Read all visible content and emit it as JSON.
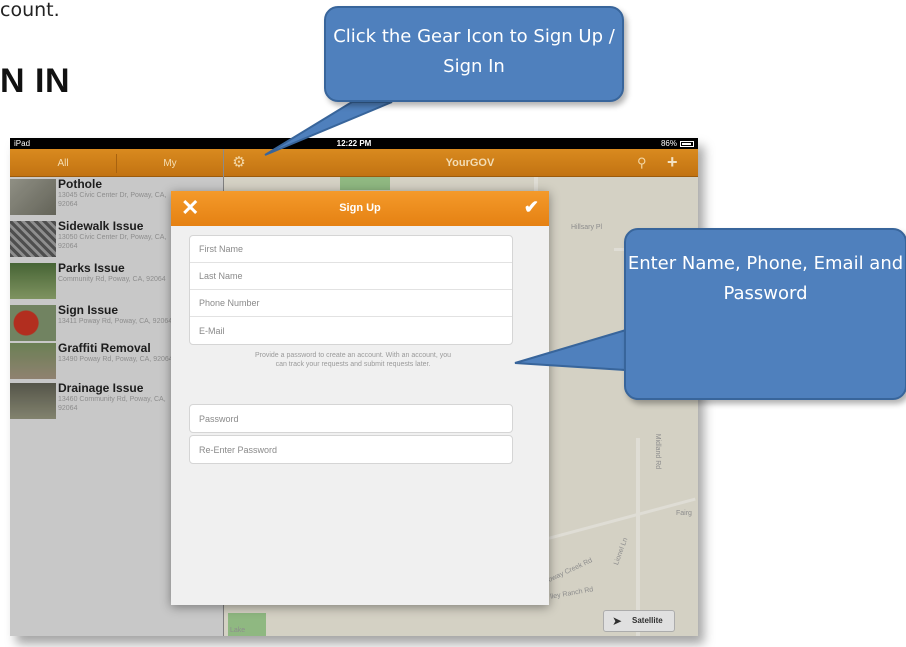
{
  "document": {
    "intro_text_fragment": "count.",
    "heading_fragment": "N IN"
  },
  "status_bar": {
    "device": "iPad",
    "time": "12:22 PM",
    "battery": "86%"
  },
  "nav": {
    "segment_all": "All",
    "segment_my": "My",
    "title": "YourGOV"
  },
  "sidebar": {
    "items": [
      {
        "title": "Pothole",
        "address": "13045 Civic Center Dr, Poway, CA, 92064"
      },
      {
        "title": "Sidewalk Issue",
        "address": "13050 Civic Center Dr, Poway, CA, 92064"
      },
      {
        "title": "Parks Issue",
        "address": "Community Rd, Poway, CA, 92064"
      },
      {
        "title": "Sign Issue",
        "address": "13411 Poway Rd, Poway, CA, 92064"
      },
      {
        "title": "Graffiti Removal",
        "address": "13490 Poway Rd, Poway, CA, 92064"
      },
      {
        "title": "Drainage Issue",
        "address": "13460 Community Rd, Poway, CA, 92064"
      }
    ]
  },
  "map": {
    "labels": {
      "hillsary": "Hillsary Pl",
      "midland": "Midland Rd",
      "fairg": "Fairg",
      "poway_creek": "Poway Creek Rd",
      "lionel": "Lionel Ln",
      "valley_ranch": "lley Ranch Rd",
      "bottom_park": "Lake"
    },
    "satellite_button": "Satellite"
  },
  "modal": {
    "title": "Sign Up",
    "fields": {
      "first_name": "First Name",
      "last_name": "Last Name",
      "phone": "Phone Number",
      "email": "E-Mail",
      "password": "Password",
      "re_password": "Re-Enter Password"
    },
    "helper_text": "Provide a password to create an account. With an account, you can track your requests and submit requests later."
  },
  "callouts": {
    "gear": "Click the Gear Icon to Sign Up / Sign  In",
    "fields": "Enter Name, Phone, Email and Password"
  },
  "colors": {
    "nav_orange": "#d98a1f",
    "modal_header_orange": "#f49a2a",
    "callout_blue": "#4f80bd"
  }
}
